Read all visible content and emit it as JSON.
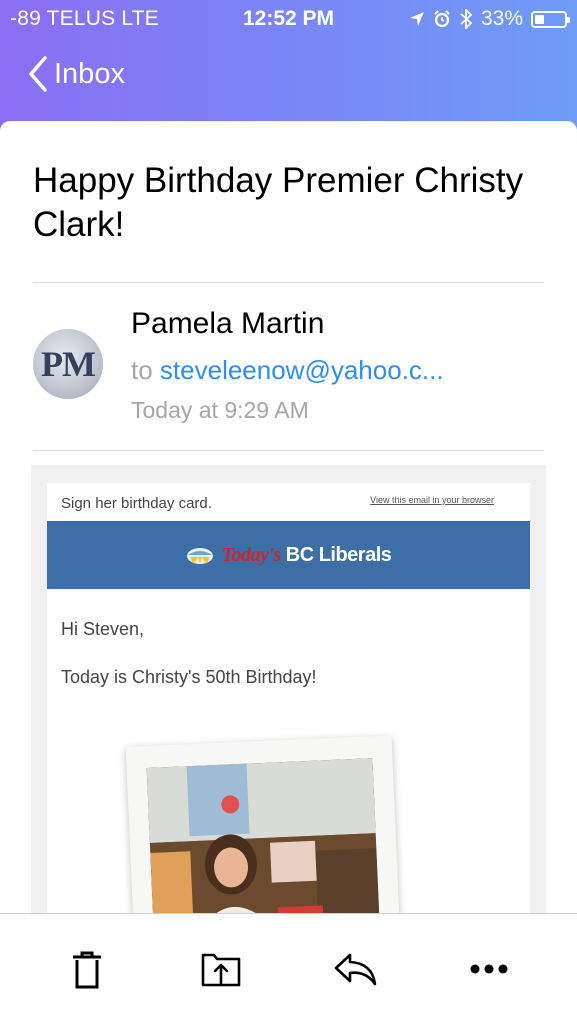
{
  "status_bar": {
    "carrier": "-89 TELUS  LTE",
    "time": "12:52 PM",
    "battery": "33%",
    "battery_level": 0.33
  },
  "nav": {
    "back_label": "Inbox"
  },
  "email": {
    "subject": "Happy Birthday Premier Christy Clark!",
    "avatar_initials": "PM",
    "sender": "Pamela Martin",
    "to_prefix": "to",
    "to_address": "steveleenow@yahoo.c...",
    "date": "Today at 9:29 AM"
  },
  "email_body": {
    "preheader": "Sign her birthday card.",
    "browser_link": "View this email in your browser",
    "logo_todays": "Today's",
    "logo_rest": "BC Liberals",
    "greeting": "Hi Steven,",
    "message": "Today is Christy's 50th Birthday!"
  },
  "toolbar": {
    "icons": [
      "trash-icon",
      "move-icon",
      "reply-icon",
      "more-icon"
    ]
  },
  "colors": {
    "accent": "#2f8cf0",
    "banner": "#3d6ea5",
    "header_gradient_start": "#8a6ef3",
    "header_gradient_end": "#6e9cf7"
  }
}
